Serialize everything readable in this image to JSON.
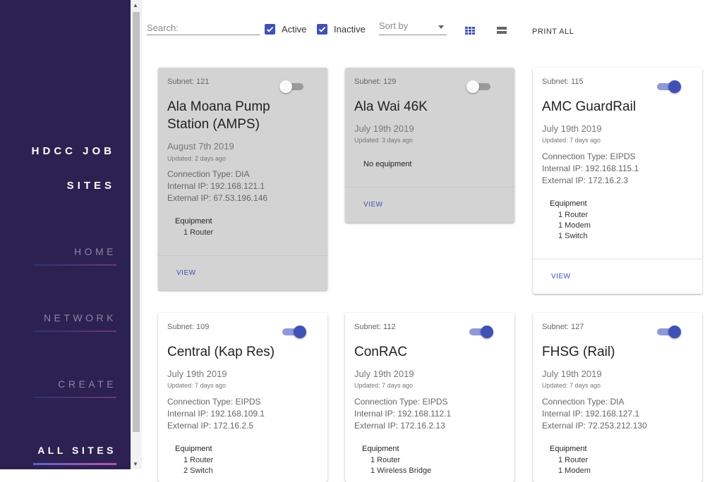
{
  "sidebar": {
    "brand_line1": "HDCC JOB",
    "brand_line2": "SITES",
    "items": [
      {
        "label": "HOME"
      },
      {
        "label": "NETWORK"
      },
      {
        "label": "CREATE"
      },
      {
        "label": "ALL SITES"
      }
    ]
  },
  "toolbar": {
    "search_placeholder": "Search:",
    "active_label": "Active",
    "active_checked": true,
    "inactive_label": "Inactive",
    "inactive_checked": true,
    "sort_placeholder": "Sort by",
    "print_all_label": "PRINT ALL"
  },
  "colors": {
    "sidebar_bg": "#2c2150",
    "accent": "#3f51b5",
    "inactive_card_bg": "#d3d3d3"
  },
  "cards": [
    {
      "subnet": "Subnet: 121",
      "active": false,
      "title": "Ala Moana Pump Station (AMPS)",
      "date": "August 7th 2019",
      "updated": "Updated: 2 days ago",
      "connection": "Connection Type: DIA",
      "internal_ip": "Internal IP: 192.168.121.1",
      "external_ip": "External IP: 67.53.196.146",
      "equipment_title": "Equipment",
      "equipment": [
        "1 Router"
      ],
      "view_label": "VIEW"
    },
    {
      "subnet": "Subnet: 129",
      "active": false,
      "title": "Ala Wai 46K",
      "date": "July 19th 2019",
      "updated": "Updated: 3 days ago",
      "no_equipment": "No equipment",
      "view_label": "VIEW"
    },
    {
      "subnet": "Subnet: 115",
      "active": true,
      "title": "AMC GuardRail",
      "date": "July 19th 2019",
      "updated": "Updated: 7 days ago",
      "connection": "Connection Type: EIPDS",
      "internal_ip": "Internal IP: 192.168.115.1",
      "external_ip": "External IP: 172.16.2.3",
      "equipment_title": "Equipment",
      "equipment": [
        "1 Router",
        "1 Modem",
        "1 Switch"
      ],
      "view_label": "VIEW"
    },
    {
      "subnet": "Subnet: 109",
      "active": true,
      "title": "Central (Kap Res)",
      "date": "July 19th 2019",
      "updated": "Updated: 7 days ago",
      "connection": "Connection Type: EIPDS",
      "internal_ip": "Internal IP: 192.168.109.1",
      "external_ip": "External IP: 172.16.2.5",
      "equipment_title": "Equipment",
      "equipment": [
        "1 Router",
        "2 Switch"
      ]
    },
    {
      "subnet": "Subnet: 112",
      "active": true,
      "title": "ConRAC",
      "date": "July 19th 2019",
      "updated": "Updated: 7 days ago",
      "connection": "Connection Type: EIPDS",
      "internal_ip": "Internal IP: 192.168.112.1",
      "external_ip": "External IP: 172.16.2.13",
      "equipment_title": "Equipment",
      "equipment": [
        "1 Router",
        "1 Wireless Bridge"
      ]
    },
    {
      "subnet": "Subnet: 127",
      "active": true,
      "title": "FHSG (Rail)",
      "date": "July 19th 2019",
      "updated": "Updated: 7 days ago",
      "connection": "Connection Type: DIA",
      "internal_ip": "Internal IP: 192.168.127.1",
      "external_ip": "External IP: 72.253.212.130",
      "equipment_title": "Equipment",
      "equipment": [
        "1 Router",
        "1 Modem"
      ]
    }
  ]
}
